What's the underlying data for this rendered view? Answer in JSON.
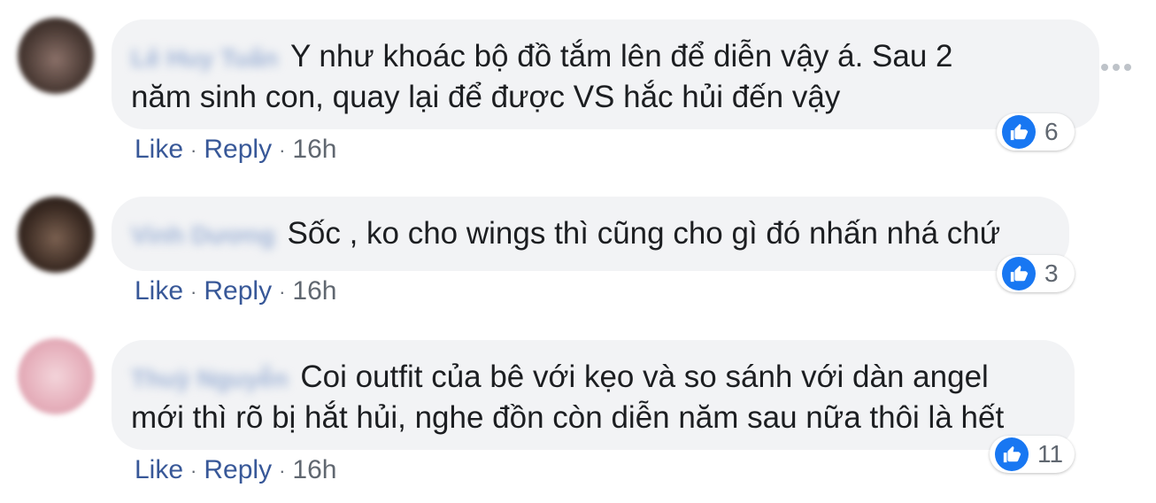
{
  "comments": [
    {
      "author": "Lê Huy Tuấn",
      "text_lines": [
        "Y như khoác bộ đồ tắm lên để diễn vậy á. Sau 2",
        "năm sinh con, quay lại để được VS hắc hủi đến vậy"
      ],
      "like_label": "Like",
      "reply_label": "Reply",
      "time": "16h",
      "reaction_count": "6",
      "avatar_color": "#5a4a44"
    },
    {
      "author": "Vinh Dương",
      "text_lines": [
        "Sốc , ko cho wings thì cũng cho gì đó nhấn nhá chứ"
      ],
      "like_label": "Like",
      "reply_label": "Reply",
      "time": "16h",
      "reaction_count": "3",
      "avatar_color": "#4a3a30"
    },
    {
      "author": "Thuỳ Nguyễn",
      "text_lines": [
        "Coi outfit của bê với kẹo và so sánh với dàn angel",
        "mới thì rõ bị hắt hủi, nghe đồn còn diễn năm sau nữa thôi là hết"
      ],
      "like_label": "Like",
      "reply_label": "Reply",
      "time": "16h",
      "reaction_count": "11",
      "avatar_color": "#e8b9c2"
    }
  ],
  "colors": {
    "like_blue": "#1877f2",
    "link": "#385898",
    "bubble": "#f2f3f5",
    "meta": "#606770"
  },
  "icons": {
    "reaction": "thumbs-up-icon",
    "more": "more-options-icon"
  }
}
